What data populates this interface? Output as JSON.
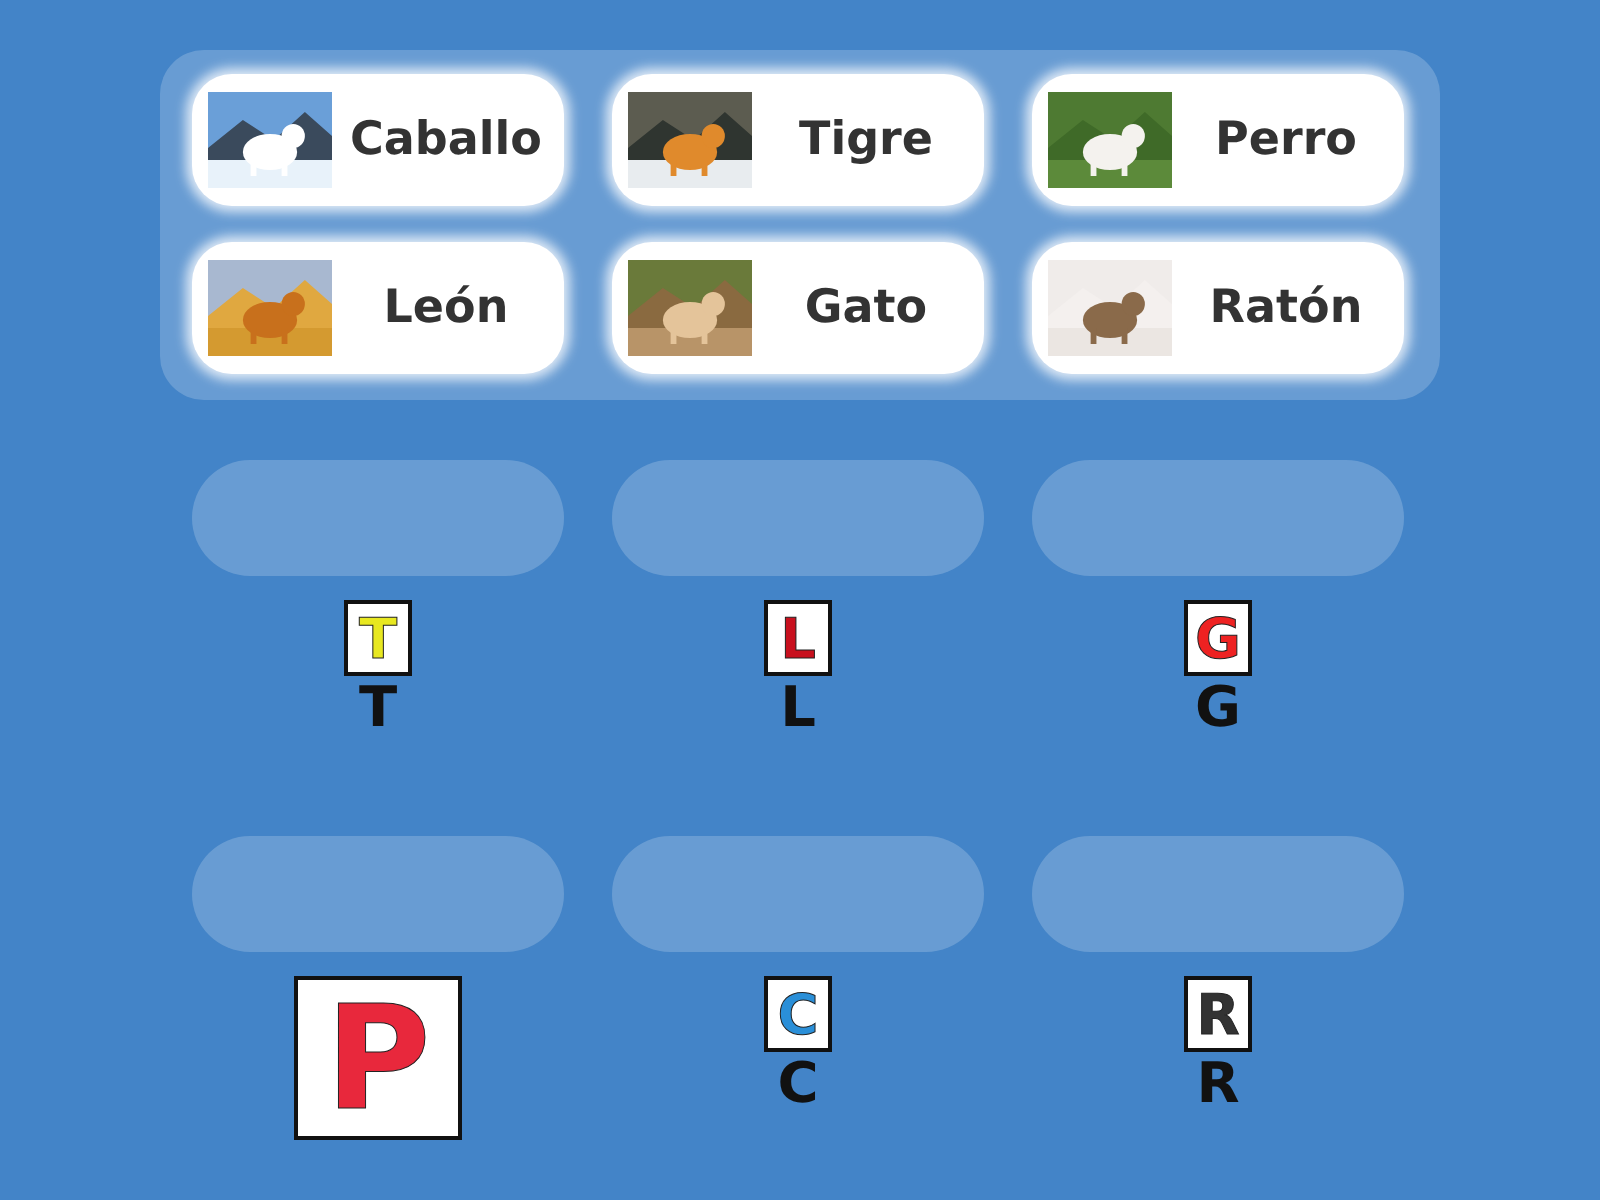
{
  "cards": [
    {
      "label": "Caballo"
    },
    {
      "label": "Tigre"
    },
    {
      "label": "Perro"
    },
    {
      "label": "León"
    },
    {
      "label": "Gato"
    },
    {
      "label": "Ratón"
    }
  ],
  "targets": [
    {
      "kind": "small",
      "tile": "T",
      "color": "#e8e820",
      "label": "T"
    },
    {
      "kind": "small",
      "tile": "L",
      "color": "#c8101e",
      "label": "L"
    },
    {
      "kind": "small",
      "tile": "G",
      "color": "#ee2222",
      "label": "G"
    },
    {
      "kind": "large",
      "tile": "P",
      "color": "#e8283c"
    },
    {
      "kind": "small",
      "tile": "C",
      "color": "#2a8fd8",
      "label": "C"
    },
    {
      "kind": "small",
      "tile": "R",
      "color": "#333333",
      "label": "R"
    }
  ]
}
